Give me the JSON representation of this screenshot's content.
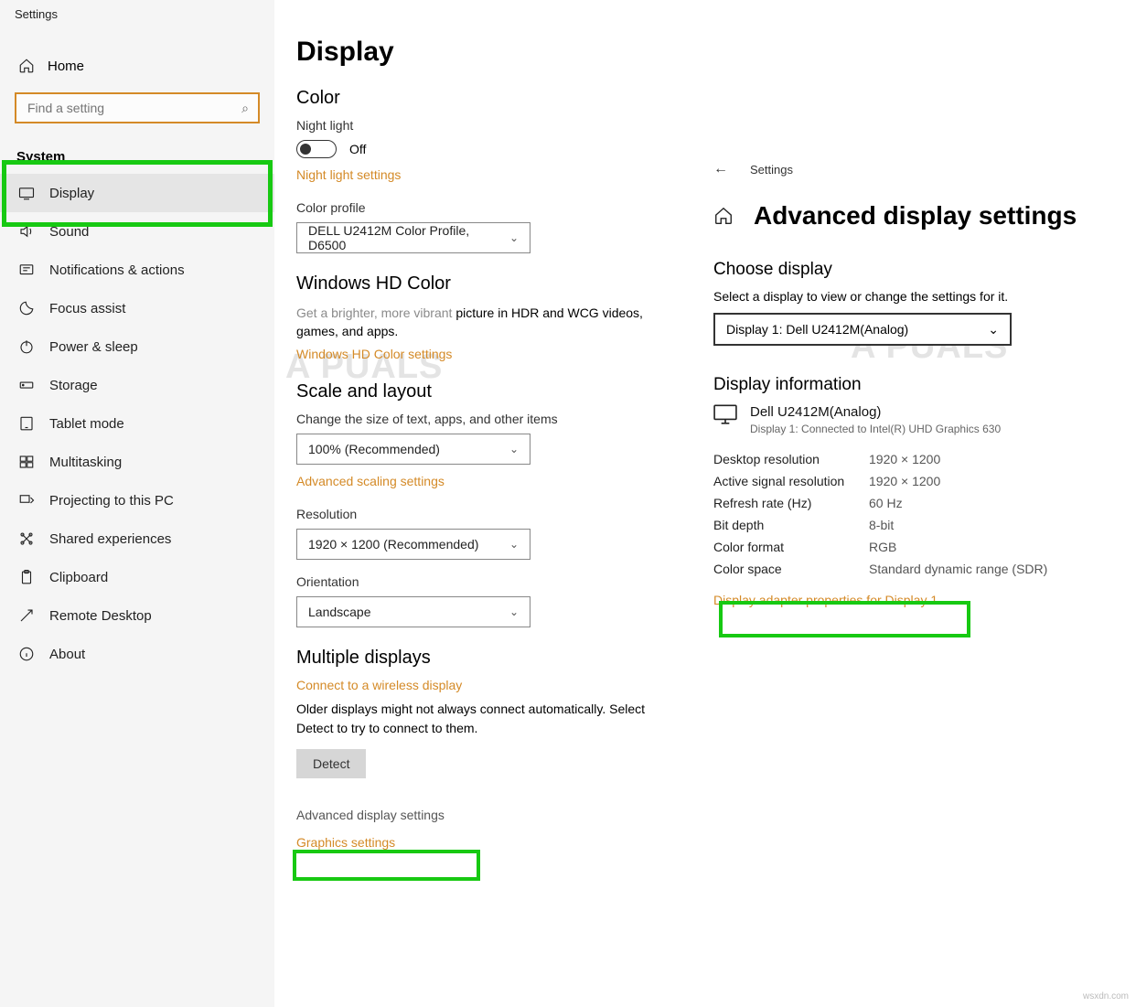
{
  "window_title": "Settings",
  "sidebar": {
    "home": "Home",
    "search_placeholder": "Find a setting",
    "category": "System",
    "items": [
      {
        "label": "Display"
      },
      {
        "label": "Sound"
      },
      {
        "label": "Notifications & actions"
      },
      {
        "label": "Focus assist"
      },
      {
        "label": "Power & sleep"
      },
      {
        "label": "Storage"
      },
      {
        "label": "Tablet mode"
      },
      {
        "label": "Multitasking"
      },
      {
        "label": "Projecting to this PC"
      },
      {
        "label": "Shared experiences"
      },
      {
        "label": "Clipboard"
      },
      {
        "label": "Remote Desktop"
      },
      {
        "label": "About"
      }
    ]
  },
  "display": {
    "title": "Display",
    "color_heading": "Color",
    "night_light_label": "Night light",
    "night_light_state": "Off",
    "night_light_link": "Night light settings",
    "color_profile_label": "Color profile",
    "color_profile_value": "DELL U2412M Color Profile, D6500",
    "hd_heading": "Windows HD Color",
    "hd_para_pre": "Get a brighter, more vibrant ",
    "hd_para_post": "picture in HDR and WCG videos, games, and apps.",
    "hd_link": "Windows HD Color settings",
    "scale_heading": "Scale and layout",
    "scale_label": "Change the size of text, apps, and other items",
    "scale_value": "100% (Recommended)",
    "adv_scaling_link": "Advanced scaling settings",
    "res_label": "Resolution",
    "res_value": "1920 × 1200 (Recommended)",
    "orient_label": "Orientation",
    "orient_value": "Landscape",
    "multi_heading": "Multiple displays",
    "connect_link": "Connect to a wireless display",
    "detect_para": "Older displays might not always connect automatically. Select Detect to try to connect to them.",
    "detect_btn": "Detect",
    "adv_disp_link": "Advanced display settings",
    "graphics_link": "Graphics settings"
  },
  "right": {
    "back_label": "Settings",
    "title": "Advanced display settings",
    "choose_heading": "Choose display",
    "choose_desc": "Select a display to view or change the settings for it.",
    "choose_value": "Display 1: Dell U2412M(Analog)",
    "info_heading": "Display information",
    "monitor_name": "Dell U2412M(Analog)",
    "monitor_sub": "Display 1: Connected to Intel(R) UHD Graphics 630",
    "rows": [
      {
        "k": "Desktop resolution",
        "v": "1920 × 1200"
      },
      {
        "k": "Active signal resolution",
        "v": "1920 × 1200"
      },
      {
        "k": "Refresh rate (Hz)",
        "v": "60 Hz"
      },
      {
        "k": "Bit depth",
        "v": "8-bit"
      },
      {
        "k": "Color format",
        "v": "RGB"
      },
      {
        "k": "Color space",
        "v": "Standard dynamic range (SDR)"
      }
    ],
    "adapter_link": "Display adapter properties for Display 1"
  },
  "watermark": "A   PUALS",
  "corner": "wsxdn.com"
}
